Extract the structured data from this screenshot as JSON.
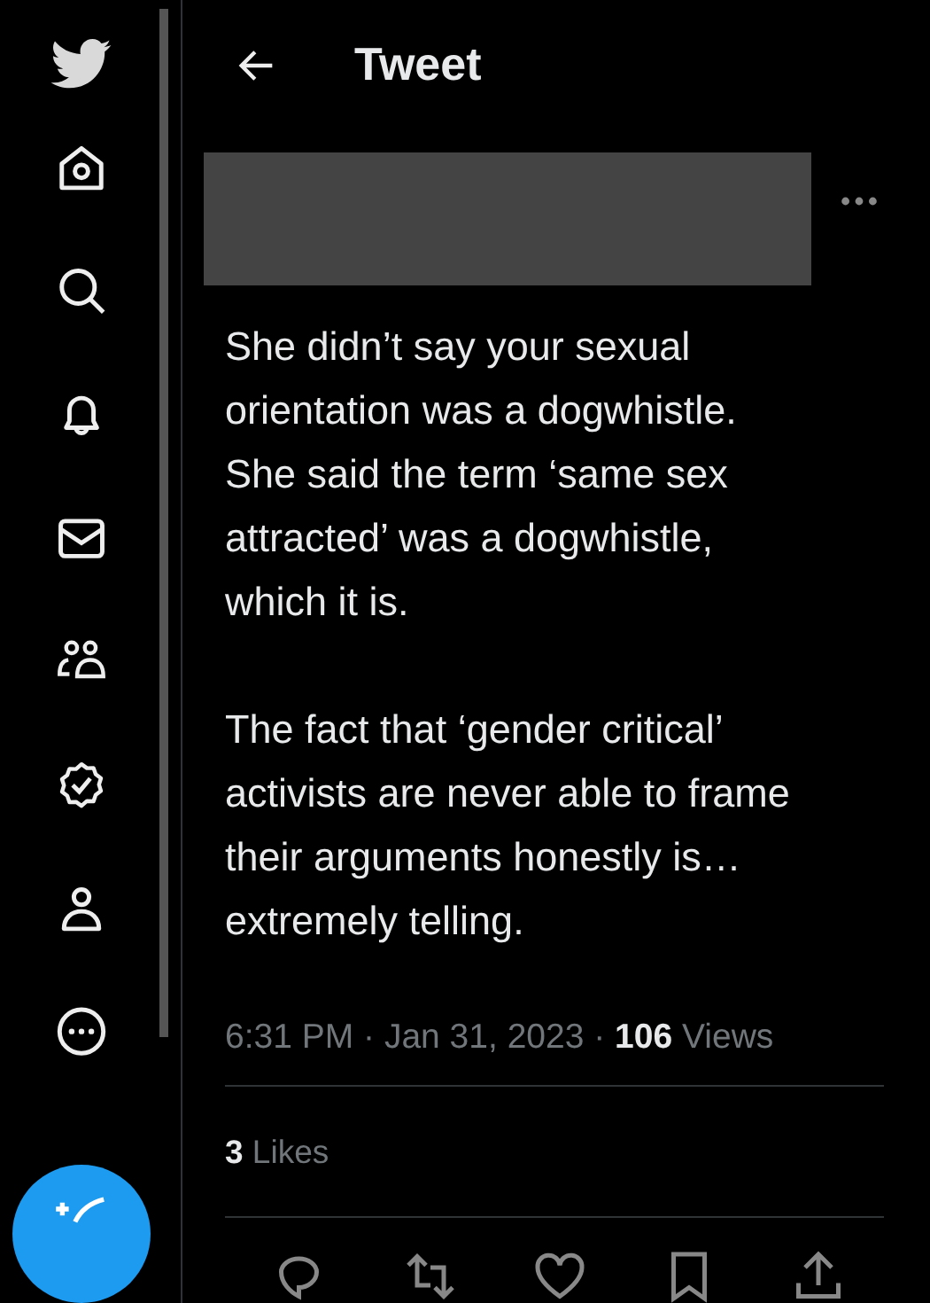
{
  "header": {
    "title": "Tweet"
  },
  "tweet": {
    "paragraphs": [
      "She didn’t say your sexual orientation was a dogwhistle. She said the term ‘same sex attracted’ was a dogwhistle, which it is.",
      "The fact that ‘gender critical’ activists are never able to frame their arguments honestly is… extremely telling."
    ],
    "timestamp": "6:31 PM · Jan 31, 2023 · ",
    "views": "**106** Views",
    "likes": "**3** Likes"
  }
}
